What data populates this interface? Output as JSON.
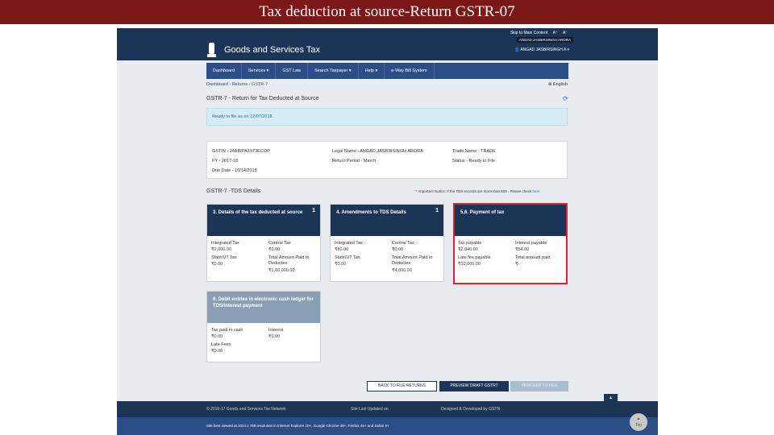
{
  "slide": {
    "title": "Tax deduction at source-Return GSTR-07"
  },
  "topbar": {
    "skip": "Skip to Main Content",
    "font_small": "A⁺",
    "font_large": "A⁻",
    "user_tip": "ANGAD JASBIRSINGH ARORA",
    "user_menu": "ANGAD JASBIRSINGH A",
    "portal_title": "Goods and Services Tax"
  },
  "nav": {
    "items": [
      {
        "label": "Dashboard"
      },
      {
        "label": "Services ▾"
      },
      {
        "label": "GST Law"
      },
      {
        "label": "Search Taxpayer ▾"
      },
      {
        "label": "Help ▾"
      },
      {
        "label": "e-Way Bill System"
      }
    ]
  },
  "breadcrumb": {
    "dashboard": "Dashboard",
    "returns": "Returns",
    "current": "GSTR-7"
  },
  "lang": "English",
  "page_title": "GSTR-7 - Return for Tax Deducted at Source",
  "notice": "Ready to file as on 12/07/2018.",
  "info": {
    "gstin": "GSTIN - 24AIRPA1573ECOP",
    "fy": "FY - 2017-18",
    "due_date": "Due Date - 10/14/2018",
    "legal_name": "Legal Name - ANGAD JASBIRSINGH ARORA",
    "return_period": "Return Period - March",
    "trade_name": "Trade Name - TRADE",
    "status": "Status - Ready to File"
  },
  "details": {
    "title": "GSTR-7 -TDS Details",
    "imp_req": "**",
    "imp_text": "Important Notice: If the TDS records are more than 500 . Please check",
    "imp_link": "here"
  },
  "tiles": [
    {
      "title": "3. Details of the tax deducted at source",
      "count": "1",
      "l1": "Integrated Tax",
      "v1": "₹2,000.00",
      "l2": "Central Tax",
      "v2": "₹0.00",
      "l3": "State/UT Tax",
      "v3": "₹0.00",
      "l4": "Total Amount Paid to Deductee",
      "v4": "₹1,00,000.00"
    },
    {
      "title": "4. Amendments to TDS Details",
      "count": "1",
      "l1": "Integrated Tax",
      "v1": "₹80.00",
      "l2": "Central Tax",
      "v2": "₹0.00",
      "l3": "State/UT Tax",
      "v3": "₹0.00",
      "l4": "Total Amount Paid to Deductee",
      "v4": "₹4,000.00"
    },
    {
      "title": "5,6. Payment of tax",
      "l1": "Tax payable",
      "v1": "₹2,040.00",
      "l2": "Interest payable",
      "v2": "₹54.00",
      "l3": "Late fee payable",
      "v3": "₹10,000.00",
      "l4": "Total amount paid",
      "v4": "₹-"
    },
    {
      "title": "8. Debit entries in electronic cash ledger for TDS/interest payment",
      "l1": "Tax paid in cash",
      "v1": "₹0.00",
      "l2": "Interest",
      "v2": "₹0.00",
      "l3": "Late Fees",
      "v3": "₹0.00"
    }
  ],
  "buttons": {
    "back": "BACK TO FILE RETURNS",
    "preview": "PREVIEW DRAFT GSTR7",
    "proceed": "PROCEED TO FILE"
  },
  "footer": {
    "copyright": "© 2016-17 Goods and Services Tax Network",
    "updated": "Site Last Updated on",
    "designed": "Designed & Developed by GSTN",
    "browser_note": "Site best viewed at 1024 x 768 resolution in Internet Explorer 10+, Google Chrome 49+, Firefox 45+ and Safari 6+",
    "top_label": "Top"
  }
}
